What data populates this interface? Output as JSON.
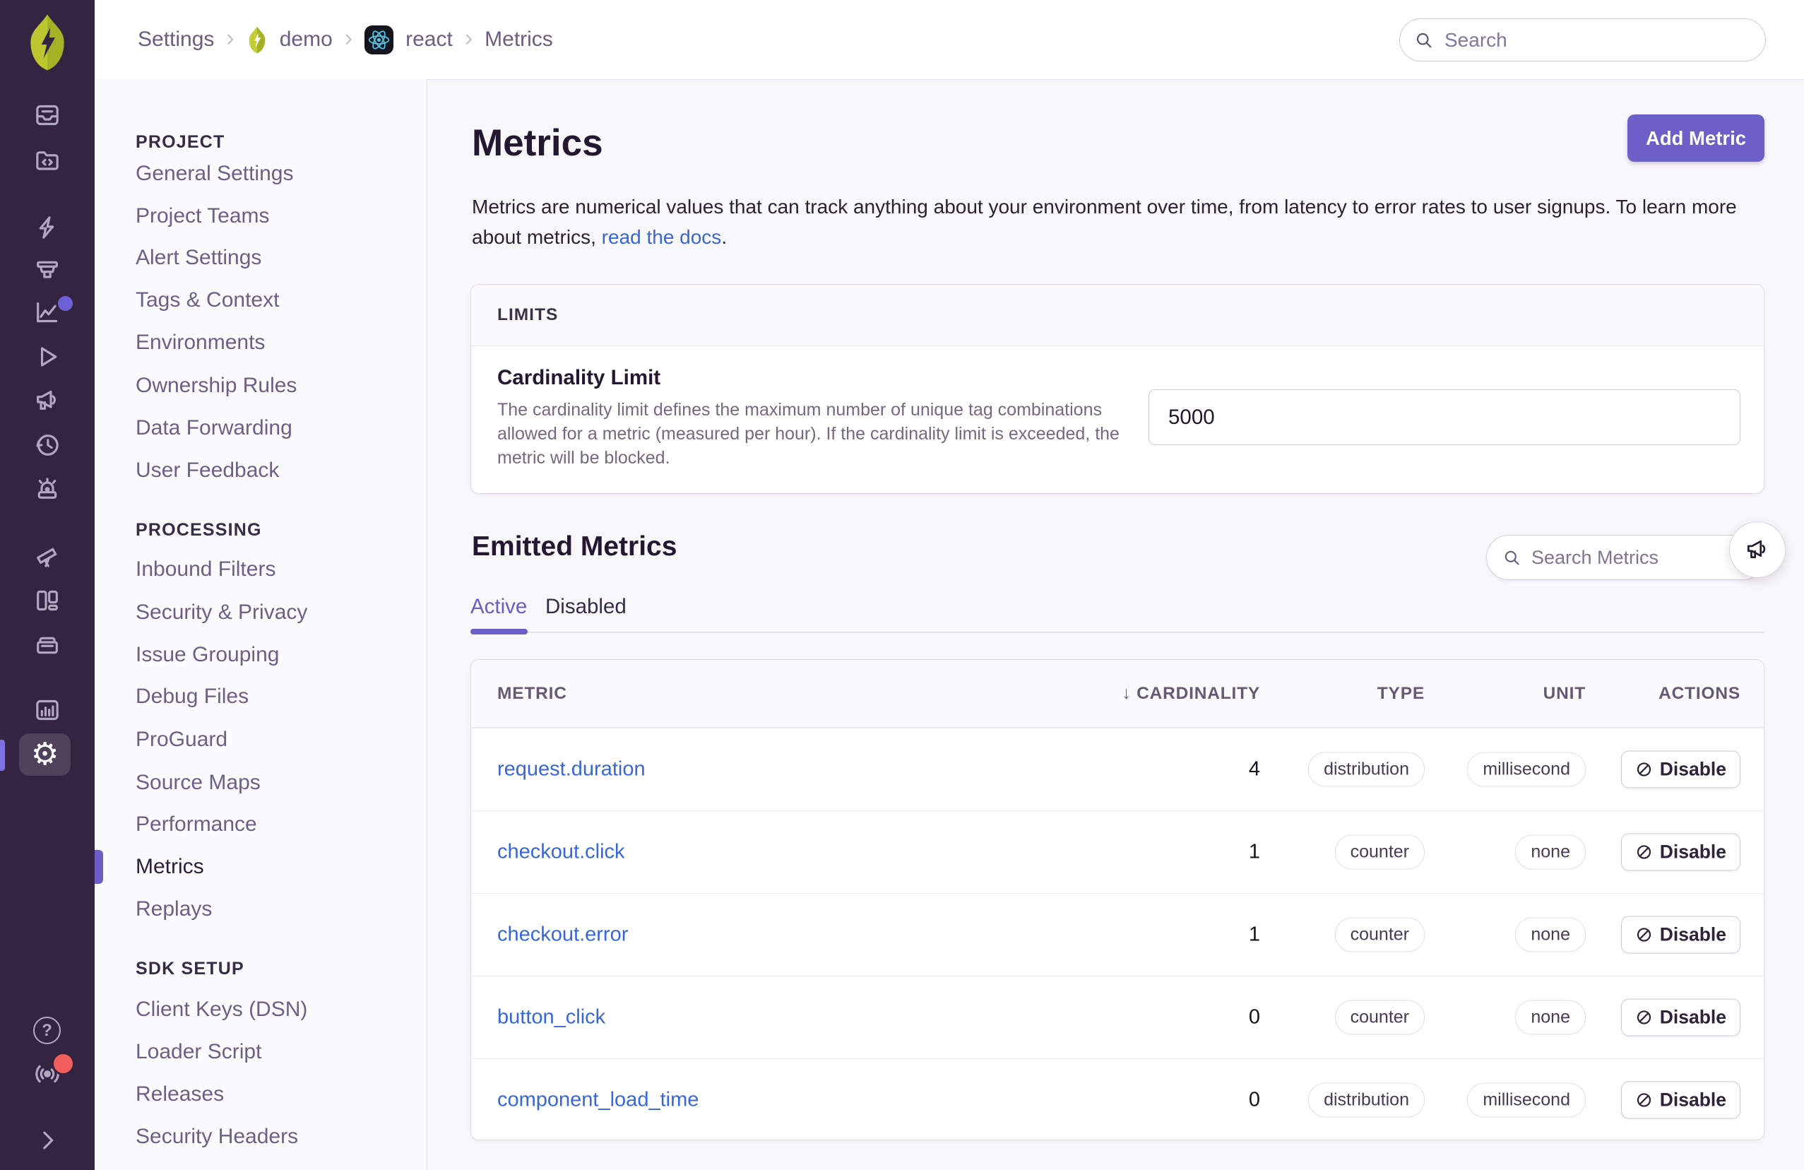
{
  "app": {
    "colors": {
      "accent_purple": "#6c5fc7",
      "link_blue": "#3767d8",
      "rail_bg": "#352441",
      "badge_red": "#f25d5d",
      "page_bg": "#f8f7fa",
      "org_avatar_lime": "#bcc72f",
      "react_cyan": "#56c2e1"
    }
  },
  "icons": {
    "chevron_sep": "›",
    "sort_desc": "↓",
    "gear": "⚙",
    "help": "?"
  },
  "breadcrumbs": {
    "items": [
      {
        "label": "Settings"
      },
      {
        "label": "demo",
        "icon": "org-avatar"
      },
      {
        "label": "react",
        "icon": "react-logo"
      },
      {
        "label": "Metrics"
      }
    ]
  },
  "topbar": {
    "search_placeholder": "Search"
  },
  "rail": {
    "icons": [
      "sentry-logo",
      "inbox-icon",
      "code-folder-icon",
      "lightning-icon",
      "funnel-icon",
      "chart-line-icon",
      "play-icon",
      "megaphone-icon",
      "clock-icon",
      "siren-icon",
      "telescope-icon",
      "layout-icon",
      "box-icon",
      "bar-chart-icon",
      "gear-icon",
      "help-icon",
      "broadcast-icon",
      "chevron-right-icon"
    ],
    "active_icon": "gear-icon"
  },
  "sidebar": {
    "sections": [
      {
        "title": "PROJECT",
        "items": [
          "General Settings",
          "Project Teams",
          "Alert Settings",
          "Tags & Context",
          "Environments",
          "Ownership Rules",
          "Data Forwarding",
          "User Feedback"
        ]
      },
      {
        "title": "PROCESSING",
        "items": [
          "Inbound Filters",
          "Security & Privacy",
          "Issue Grouping",
          "Debug Files",
          "ProGuard",
          "Source Maps",
          "Performance",
          "Metrics",
          "Replays"
        ],
        "active_item": "Metrics"
      },
      {
        "title": "SDK SETUP",
        "items": [
          "Client Keys (DSN)",
          "Loader Script",
          "Releases",
          "Security Headers"
        ]
      }
    ]
  },
  "main": {
    "title": "Metrics",
    "add_button": "Add Metric",
    "description_before_link": "Metrics are numerical values that can track anything about your environment over time, from latency to error rates to user signups. To learn more about metrics, ",
    "description_link": "read the docs",
    "description_after_link": "."
  },
  "limits": {
    "panel_title": "LIMITS",
    "field_label": "Cardinality Limit",
    "field_help": "The cardinality limit defines the maximum number of unique tag combinations allowed for a metric (measured per hour). If the cardinality limit is exceeded, the metric will be blocked.",
    "input_value": "5000"
  },
  "emitted": {
    "title": "Emitted Metrics",
    "search_placeholder": "Search Metrics",
    "tabs": [
      {
        "label": "Active",
        "active": true
      },
      {
        "label": "Disabled",
        "active": false
      }
    ],
    "table": {
      "columns": [
        "METRIC",
        "CARDINALITY",
        "TYPE",
        "UNIT",
        "ACTIONS"
      ],
      "sorted_by": "CARDINALITY",
      "disable_label": "Disable",
      "rows": [
        {
          "name": "request.duration",
          "cardinality": "4",
          "type": "distribution",
          "unit": "millisecond"
        },
        {
          "name": "checkout.click",
          "cardinality": "1",
          "type": "counter",
          "unit": "none"
        },
        {
          "name": "checkout.error",
          "cardinality": "1",
          "type": "counter",
          "unit": "none"
        },
        {
          "name": "button_click",
          "cardinality": "0",
          "type": "counter",
          "unit": "none"
        },
        {
          "name": "component_load_time",
          "cardinality": "0",
          "type": "distribution",
          "unit": "millisecond"
        }
      ]
    }
  }
}
